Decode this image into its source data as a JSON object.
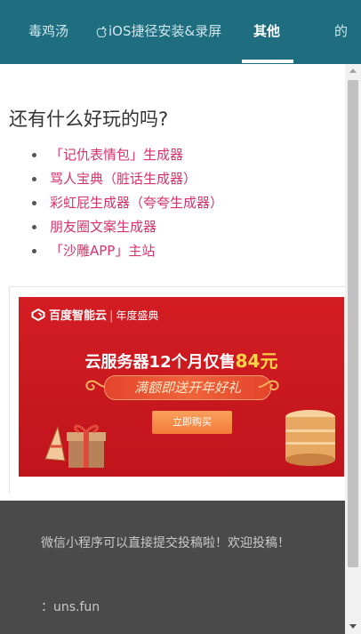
{
  "nav": {
    "tabs": [
      {
        "label": "毒鸡汤"
      },
      {
        "label": "iOS捷径安装&录屏"
      },
      {
        "label": "其他"
      },
      {
        "label": "的"
      }
    ],
    "active_index": 2
  },
  "main": {
    "heading": "还有什么好玩的吗?",
    "links": [
      "「记仇表情包」生成器",
      "骂人宝典（脏话生成器）",
      "彩虹屁生成器（夸夸生成器）",
      "朋友圈文案生成器",
      "「沙雕APP」主站"
    ]
  },
  "ad": {
    "brand": "百度智能云",
    "brand_sub": "年度盛典",
    "headline_prefix": "云服务器12个月仅售",
    "headline_price": "84元",
    "ribbon": "满额即送开年好礼",
    "button": "立即购买"
  },
  "footer": {
    "text": "微信小程序可以直接提交投稿啦！欢迎投稿！",
    "domain": "：uns.fun"
  },
  "colors": {
    "nav_bg": "#1f6e80",
    "link": "#d6336c",
    "ad_bg": "#c0141c",
    "footer_bg": "#4a4a4a"
  }
}
